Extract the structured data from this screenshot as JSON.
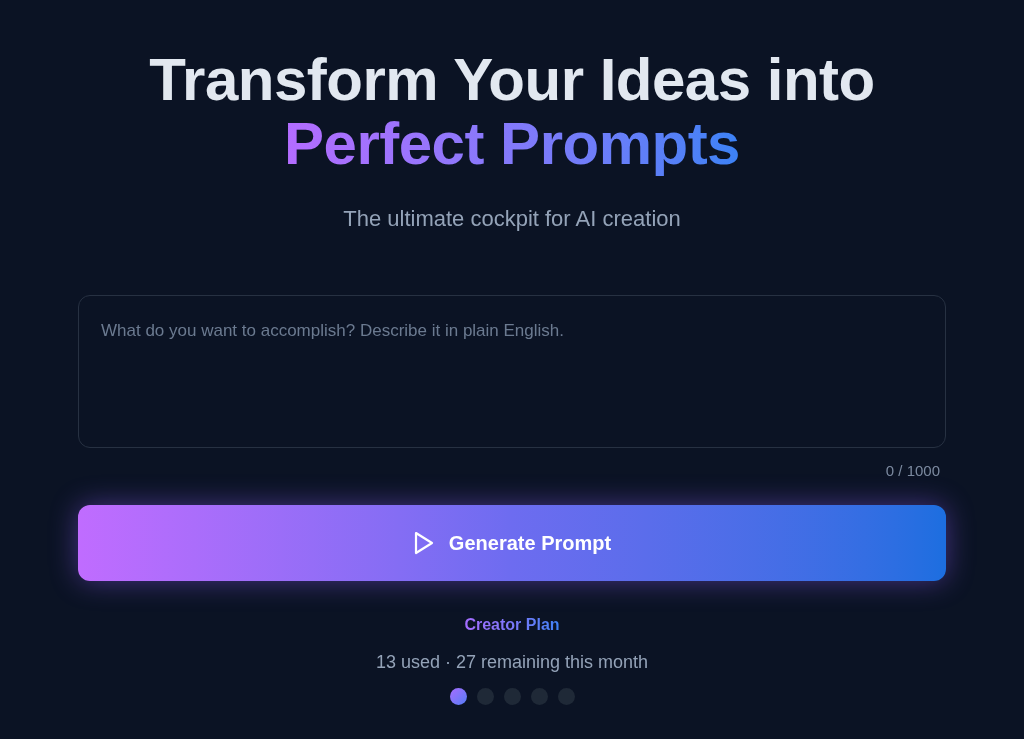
{
  "hero": {
    "title_line_1": "Transform Your Ideas into",
    "title_line_2": "Perfect Prompts",
    "subtitle": "The ultimate cockpit for AI creation"
  },
  "prompt_field": {
    "placeholder": "What do you want to accomplish? Describe it in plain English.",
    "counter": "0 / 1000"
  },
  "generate_button": {
    "label": "Generate Prompt"
  },
  "plan": {
    "name": "Creator Plan",
    "usage": "13 used · 27 remaining this month"
  },
  "pager": [
    {
      "selected": true
    },
    {
      "selected": false
    },
    {
      "selected": false
    },
    {
      "selected": false
    },
    {
      "selected": false
    }
  ]
}
